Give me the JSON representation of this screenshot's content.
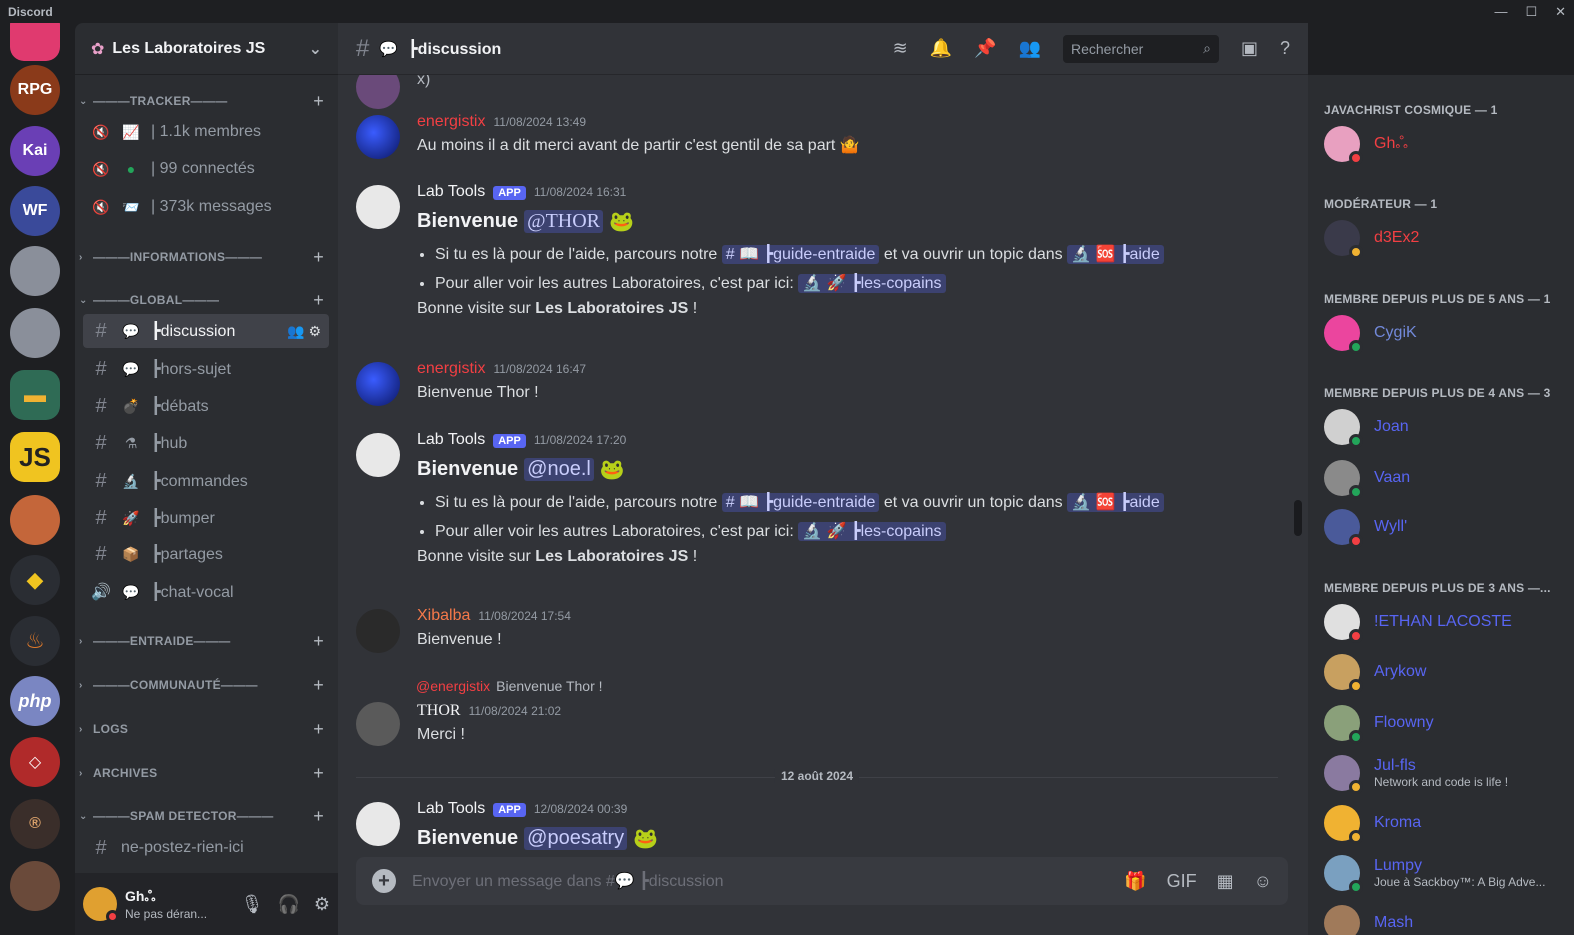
{
  "app": {
    "title": "Discord"
  },
  "guild": {
    "name": "Les Laboratoires JS"
  },
  "categories": [
    {
      "label": "TRACKER"
    },
    {
      "label": "INFORMATIONS"
    },
    {
      "label": "GLOBAL"
    },
    {
      "label": "ENTRAIDE"
    },
    {
      "label": "COMMUNAUTÉ"
    },
    {
      "label": "LOGS"
    },
    {
      "label": "ARCHIVES"
    },
    {
      "label": "SPAM DETECTOR"
    }
  ],
  "tracker": [
    {
      "label": "| 1.1k membres"
    },
    {
      "label": "| 99 connectés"
    },
    {
      "label": "| 373k messages"
    }
  ],
  "channels": [
    {
      "label": "┣discussion"
    },
    {
      "label": "┣hors-sujet"
    },
    {
      "label": "┣débats"
    },
    {
      "label": "┣hub"
    },
    {
      "label": "┣commandes"
    },
    {
      "label": "┣bumper"
    },
    {
      "label": "┣partages"
    },
    {
      "label": "┣chat-vocal"
    },
    {
      "label": "ne-postez-rien-ici"
    }
  ],
  "user": {
    "name": "Ghஃ",
    "status": "Ne pas déran..."
  },
  "header": {
    "channel": "┣discussion",
    "search_placeholder": "Rechercher"
  },
  "messages": {
    "m1": {
      "author": "energistix",
      "time": "11/08/2024 13:49",
      "text": "Au moins il a dit merci avant de partir c'est gentil de sa part 🤷"
    },
    "m2": {
      "author": "Lab Tools",
      "badge": "APP",
      "time": "11/08/2024 16:31",
      "welcome": "Bienvenue",
      "mention": "@THOR"
    },
    "m3": {
      "author": "energistix",
      "time": "11/08/2024 16:47",
      "text": "Bienvenue Thor !"
    },
    "m4": {
      "author": "Lab Tools",
      "badge": "APP",
      "time": "11/08/2024 17:20",
      "welcome": "Bienvenue",
      "mention": "@noe.l"
    },
    "m5": {
      "author": "Xibalba",
      "time": "11/08/2024 17:54",
      "text": "Bienvenue !"
    },
    "m6": {
      "reply_author": "@energistix",
      "reply_text": "Bienvenue Thor !",
      "author": "THOR",
      "time": "11/08/2024 21:02",
      "text": "Merci !"
    },
    "date_divider": "12 août 2024",
    "m7": {
      "author": "Lab Tools",
      "badge": "APP",
      "time": "12/08/2024 00:39",
      "welcome": "Bienvenue",
      "mention": "@poesatry"
    },
    "bullet1_pre": "Si tu es là pour de l'aide, parcours notre",
    "bullet1_guide": "┣guide-entraide",
    "bullet1_mid": "et va ouvrir un topic dans",
    "bullet1_aide": "┣aide",
    "bullet2_pre": "Pour aller voir les autres Laboratoires, c'est par ici:",
    "bullet2_copains": "┣les-copains",
    "visit_pre": "Bonne visite sur",
    "visit_server": "Les Laboratoires JS",
    "visit_post": "!"
  },
  "composer": {
    "placeholder": "Envoyer un message dans #💬 ┣discussion"
  },
  "member_groups": [
    {
      "label": "JAVACHRIST COSMIQUE — 1"
    },
    {
      "label": "MODÉRATEUR — 1"
    },
    {
      "label": "MEMBRE DEPUIS PLUS DE 5 ANS — 1"
    },
    {
      "label": "MEMBRE DEPUIS PLUS DE 4 ANS — 3"
    },
    {
      "label": "MEMBRE DEPUIS PLUS DE 3 ANS —..."
    }
  ],
  "members": [
    {
      "name": "Ghஃ",
      "color": "#f23f43"
    },
    {
      "name": "d3Ex2",
      "color": "#f23f43"
    },
    {
      "name": "CygiK",
      "color": "#7289da"
    },
    {
      "name": "Joan",
      "color": "#5865f2"
    },
    {
      "name": "Vaan",
      "color": "#5865f2"
    },
    {
      "name": "Wyll'",
      "color": "#5865f2"
    },
    {
      "name": "!ETHAN LACOSTE",
      "color": "#5865f2"
    },
    {
      "name": "Arykow",
      "color": "#5865f2"
    },
    {
      "name": "Floowny",
      "color": "#5865f2"
    },
    {
      "name": "Jul-fls",
      "color": "#5865f2",
      "sub": "Network and code is life !"
    },
    {
      "name": "Kroma",
      "color": "#5865f2"
    },
    {
      "name": "Lumpy",
      "color": "#5865f2",
      "sub": "Joue à Sackboy™: A Big Adve..."
    },
    {
      "name": "Mash",
      "color": "#5865f2"
    }
  ]
}
